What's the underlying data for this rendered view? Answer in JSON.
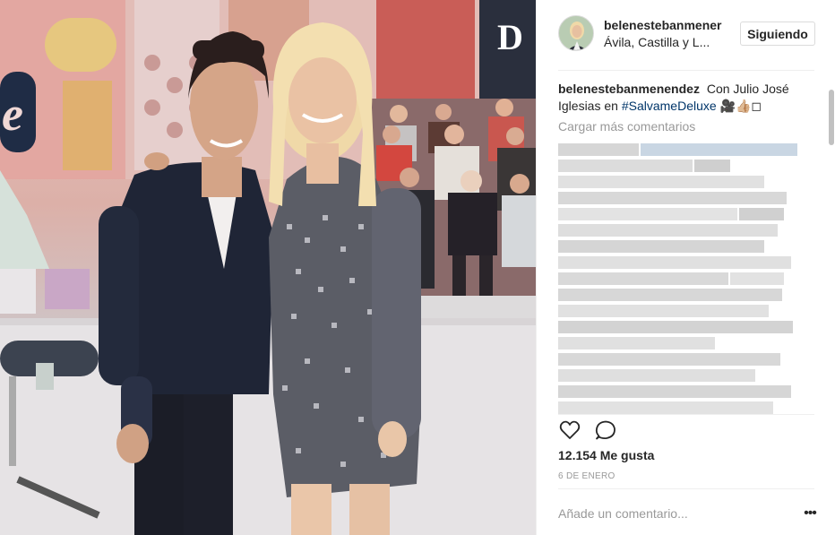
{
  "photo": {
    "icon": "post-photo"
  },
  "header": {
    "username": "belenestebanmener",
    "location": "Ávila, Castilla y L...",
    "follow_label": "Siguiendo"
  },
  "caption": {
    "username": "belenestebanmenendez",
    "text": "Con Julio José Iglesias en",
    "hashtag": "#SalvameDeluxe",
    "emoji": "🎥👍🏼◻"
  },
  "comments": {
    "load_more_label": "Cargar más comentarios"
  },
  "actions": {
    "like_icon": "heart-icon",
    "comment_icon": "comment-icon"
  },
  "likes": "12.154 Me gusta",
  "date": "6 DE ENERO",
  "add_comment": {
    "placeholder": "Añade un comentario..."
  },
  "more_options": "•••"
}
